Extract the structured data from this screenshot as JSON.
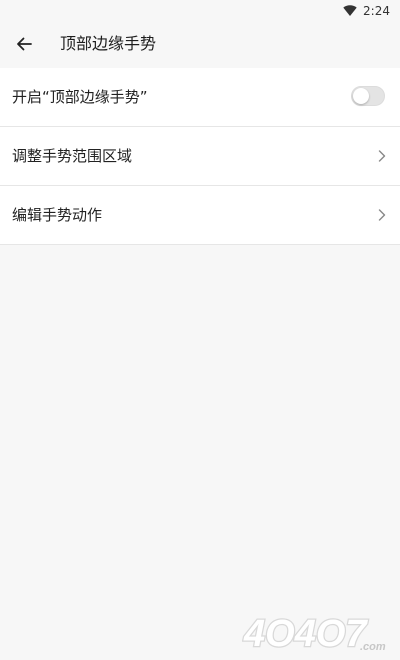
{
  "status_bar": {
    "time": "2:24",
    "wifi_icon": "wifi-icon"
  },
  "app_bar": {
    "back_icon": "arrow-left-icon",
    "title": "顶部边缘手势"
  },
  "settings": [
    {
      "label": "开启“顶部边缘手势”",
      "control": "toggle",
      "enabled": false
    },
    {
      "label": "调整手势范围区域",
      "control": "chevron-right-icon"
    },
    {
      "label": "编辑手势动作",
      "control": "chevron-right-icon"
    }
  ],
  "watermark": {
    "text": "4O4O7.com"
  },
  "colors": {
    "background": "#f7f7f7",
    "list_background": "#ffffff",
    "divider": "#e6e6e6",
    "text_primary": "#222222",
    "toggle_off": "#e4e4e4"
  }
}
